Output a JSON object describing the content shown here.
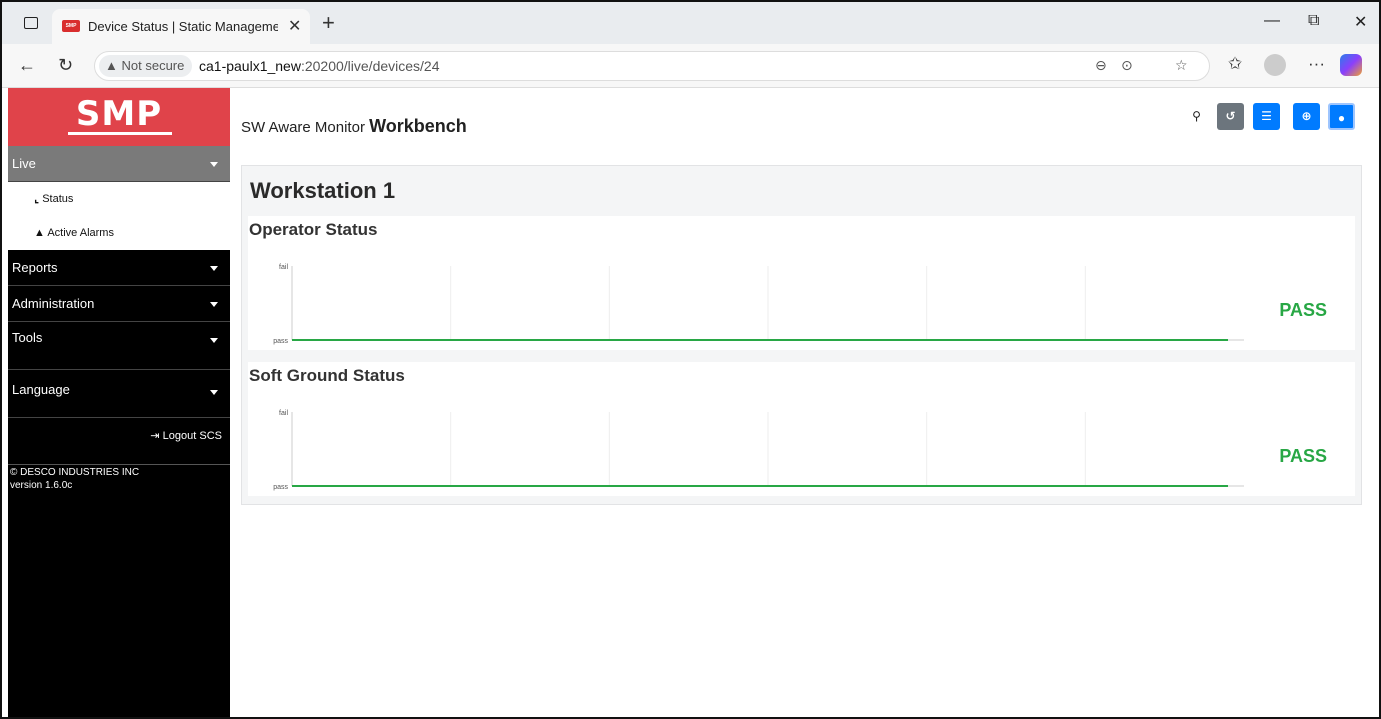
{
  "browser": {
    "tab_title": "Device Status | Static Management",
    "favicon_text": "SMP",
    "not_secure_label": "Not secure",
    "url_host": "ca1-paulx1_new",
    "url_path": ":20200/live/devices/24"
  },
  "sidebar": {
    "logo": "SMP",
    "live_label": "Live",
    "status_label": "Status",
    "alarms_label": "Active Alarms",
    "reports_label": "Reports",
    "admin_label": "Administration",
    "tools_label": "Tools",
    "language_label": "Language",
    "logout_label": "Logout SCS",
    "copyright": "© DESCO INDUSTRIES INC",
    "version": "version 1.6.0c",
    "brand_color": "#e0434a"
  },
  "header": {
    "title_prefix": "SW Aware Monitor",
    "title_strong": "Workbench"
  },
  "workstation": {
    "name": "Workstation 1",
    "operator": {
      "title": "Operator Status",
      "status": "PASS"
    },
    "ground": {
      "title": "Soft Ground Status",
      "status": "PASS"
    }
  },
  "chart_data": [
    {
      "type": "line",
      "title": "Operator Status",
      "y_categories": [
        "pass",
        "fail"
      ],
      "series": [
        {
          "values": [
            "pass",
            "pass"
          ],
          "color": "#28a745"
        }
      ],
      "grid": true
    },
    {
      "type": "line",
      "title": "Soft Ground Status",
      "y_categories": [
        "pass",
        "fail"
      ],
      "series": [
        {
          "values": [
            "pass",
            "pass"
          ],
          "color": "#28a745"
        }
      ],
      "grid": true
    }
  ]
}
